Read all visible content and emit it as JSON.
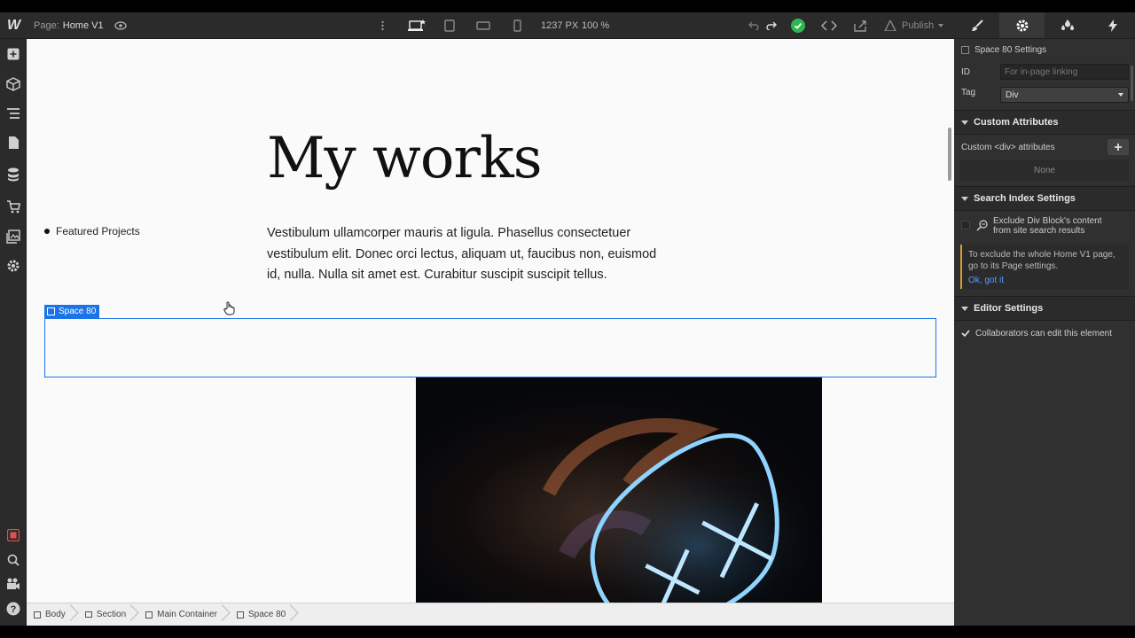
{
  "topbar": {
    "logo": "W",
    "page_label": "Page:",
    "page_name": "Home V1",
    "width_px": "1237 PX",
    "zoom": "100 %",
    "publish_label": "Publish"
  },
  "canvas": {
    "heading": "My works",
    "side_label": "Featured Projects",
    "paragraph": "Vestibulum ullamcorper mauris at ligula. Phasellus consectetuer vestibulum elit. Donec orci lectus, aliquam ut, faucibus non, euismod id, nulla. Nulla sit amet est. Curabitur suscipit suscipit tellus.",
    "selected_tag": "Space 80"
  },
  "breadcrumb": {
    "items": [
      "Body",
      "Section",
      "Main Container",
      "Space 80"
    ]
  },
  "panel": {
    "settings_title": "Space 80 Settings",
    "id_label": "ID",
    "id_placeholder": "For in-page linking",
    "tag_label": "Tag",
    "tag_value": "Div",
    "custom_attributes": {
      "heading": "Custom Attributes",
      "label": "Custom <div> attributes",
      "empty": "None"
    },
    "search_index": {
      "heading": "Search Index Settings",
      "exclude_label": "Exclude Div Block's content from site search results",
      "note": "To exclude the whole Home V1 page, go to its Page settings.",
      "link": "Ok, got it"
    },
    "editor_settings": {
      "heading": "Editor Settings",
      "collab_label": "Collaborators can edit this element"
    }
  },
  "colors": {
    "accent": "#1a73e8",
    "success": "#2fb553",
    "dark_bg": "#2b2b2b"
  }
}
